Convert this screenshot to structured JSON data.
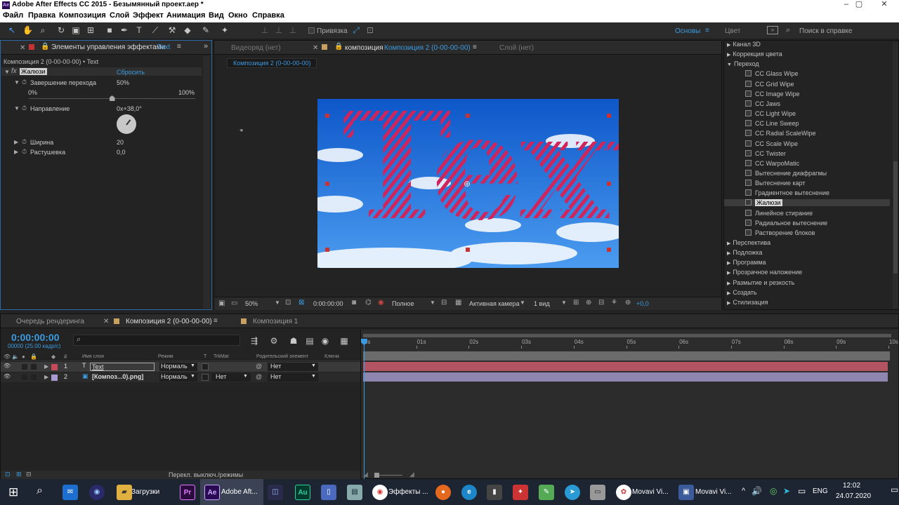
{
  "window": {
    "title": "Adobe After Effects CC 2015 - Безымянный проект.aep *",
    "logo": "Ae",
    "min": "–",
    "max": "▢",
    "close": "✕"
  },
  "menu": [
    "Файл",
    "Правка",
    "Композиция",
    "Слой",
    "Эффект",
    "Анимация",
    "Вид",
    "Окно",
    "Справка"
  ],
  "toolbar": {
    "snap_label": "Привязка",
    "workspace": "Основы",
    "workspace2": "Цвет",
    "search_placeholder": "Поиск в справке"
  },
  "effects_panel": {
    "tab": "Элементы управления эффектами",
    "tab_target": "Text",
    "breadcrumb": "Композиция 2 (0-00-00-00) • Text",
    "effect_name": "Жалюзи",
    "reset": "Сбросить",
    "transition_label": "Завершение перехода",
    "transition_value": "50%",
    "slider_min": "0%",
    "slider_max": "100%",
    "direction_label": "Направление",
    "direction_value": "0x+38,0°",
    "width_label": "Ширина",
    "width_value": "20",
    "feather_label": "Растушевка",
    "feather_value": "0,0",
    "transition_fraction": 0.5
  },
  "viewer": {
    "tab_footage": "Видеоряд (нет)",
    "tab_comp_prefix": "композиция",
    "tab_comp_name": "Композиция 2 (0-00-00-00)",
    "tab_layer": "Слой (нет)",
    "comp_chip": "Композиция 2 (0-00-00-00)",
    "comp_text": "Text",
    "zoom": "50%",
    "timecode": "0:00:00:00",
    "resolution": "Полное",
    "camera": "Активная камера",
    "views": "1 вид",
    "exposure": "+0,0"
  },
  "effects_list": {
    "items": [
      {
        "label": "Канал 3D",
        "type": "folder",
        "open": false
      },
      {
        "label": "Коррекция цвета",
        "type": "folder",
        "open": false
      },
      {
        "label": "Переход",
        "type": "folder",
        "open": true
      },
      {
        "label": "CC Glass Wipe",
        "type": "effect"
      },
      {
        "label": "CC Grid Wipe",
        "type": "effect"
      },
      {
        "label": "CC Image Wipe",
        "type": "effect"
      },
      {
        "label": "CC Jaws",
        "type": "effect"
      },
      {
        "label": "CC Light Wipe",
        "type": "effect"
      },
      {
        "label": "CC Line Sweep",
        "type": "effect"
      },
      {
        "label": "CC Radial ScaleWipe",
        "type": "effect"
      },
      {
        "label": "CC Scale Wipe",
        "type": "effect"
      },
      {
        "label": "CC Twister",
        "type": "effect"
      },
      {
        "label": "CC WarpoMatic",
        "type": "effect"
      },
      {
        "label": "Вытеснение диафрагмы",
        "type": "effect"
      },
      {
        "label": "Вытеснение карт",
        "type": "effect"
      },
      {
        "label": "Градиентное вытеснение",
        "type": "effect"
      },
      {
        "label": "Жалюзи",
        "type": "effect",
        "selected": true
      },
      {
        "label": "Линейное стирание",
        "type": "effect"
      },
      {
        "label": "Радиальное вытеснение",
        "type": "effect"
      },
      {
        "label": "Растворение блоков",
        "type": "effect"
      },
      {
        "label": "Перспектива",
        "type": "folder",
        "open": false
      },
      {
        "label": "Подложка",
        "type": "folder",
        "open": false
      },
      {
        "label": "Программа",
        "type": "folder",
        "open": false
      },
      {
        "label": "Прозрачное наложение",
        "type": "folder",
        "open": false
      },
      {
        "label": "Размытие и резкость",
        "type": "folder",
        "open": false
      },
      {
        "label": "Создать",
        "type": "folder",
        "open": false
      },
      {
        "label": "Стилизация",
        "type": "folder",
        "open": false
      }
    ]
  },
  "timeline": {
    "tab_render": "Очередь рендеринга",
    "tab_comp2": "Композиция 2 (0-00-00-00)",
    "tab_comp1": "Композиция 1",
    "timecode": "0:00:00:00",
    "fps": "00000 (25.00 кадр/с)",
    "col_name": "Имя слоя",
    "col_mode": "Режим",
    "col_t": "T",
    "col_trkmat": "TrkMat",
    "col_parent": "Родительский элемент",
    "col_keys": "Ключи",
    "ruler": [
      "0s",
      "01s",
      "02s",
      "03s",
      "04s",
      "05s",
      "06s",
      "07s",
      "08s",
      "09s",
      "10s"
    ],
    "footer": "Перекл. выключ./режимы",
    "layers": [
      {
        "num": "1",
        "name": "Text",
        "mode": "Нормаль",
        "trkmat": "",
        "parent": "Нет",
        "color": "#c84a5a"
      },
      {
        "num": "2",
        "name": "[Композ...0).png]",
        "mode": "Нормаль",
        "trkmat": "Нет",
        "parent": "Нет",
        "color": "#a89ad0"
      }
    ]
  },
  "taskbar": {
    "items": [
      "Загрузки",
      "Adobe Aft...",
      "Эффекты ...",
      "Movavi Vi...",
      "Movavi Vi..."
    ],
    "lang": "ENG",
    "time": "12:02",
    "date": "24.07.2020"
  }
}
